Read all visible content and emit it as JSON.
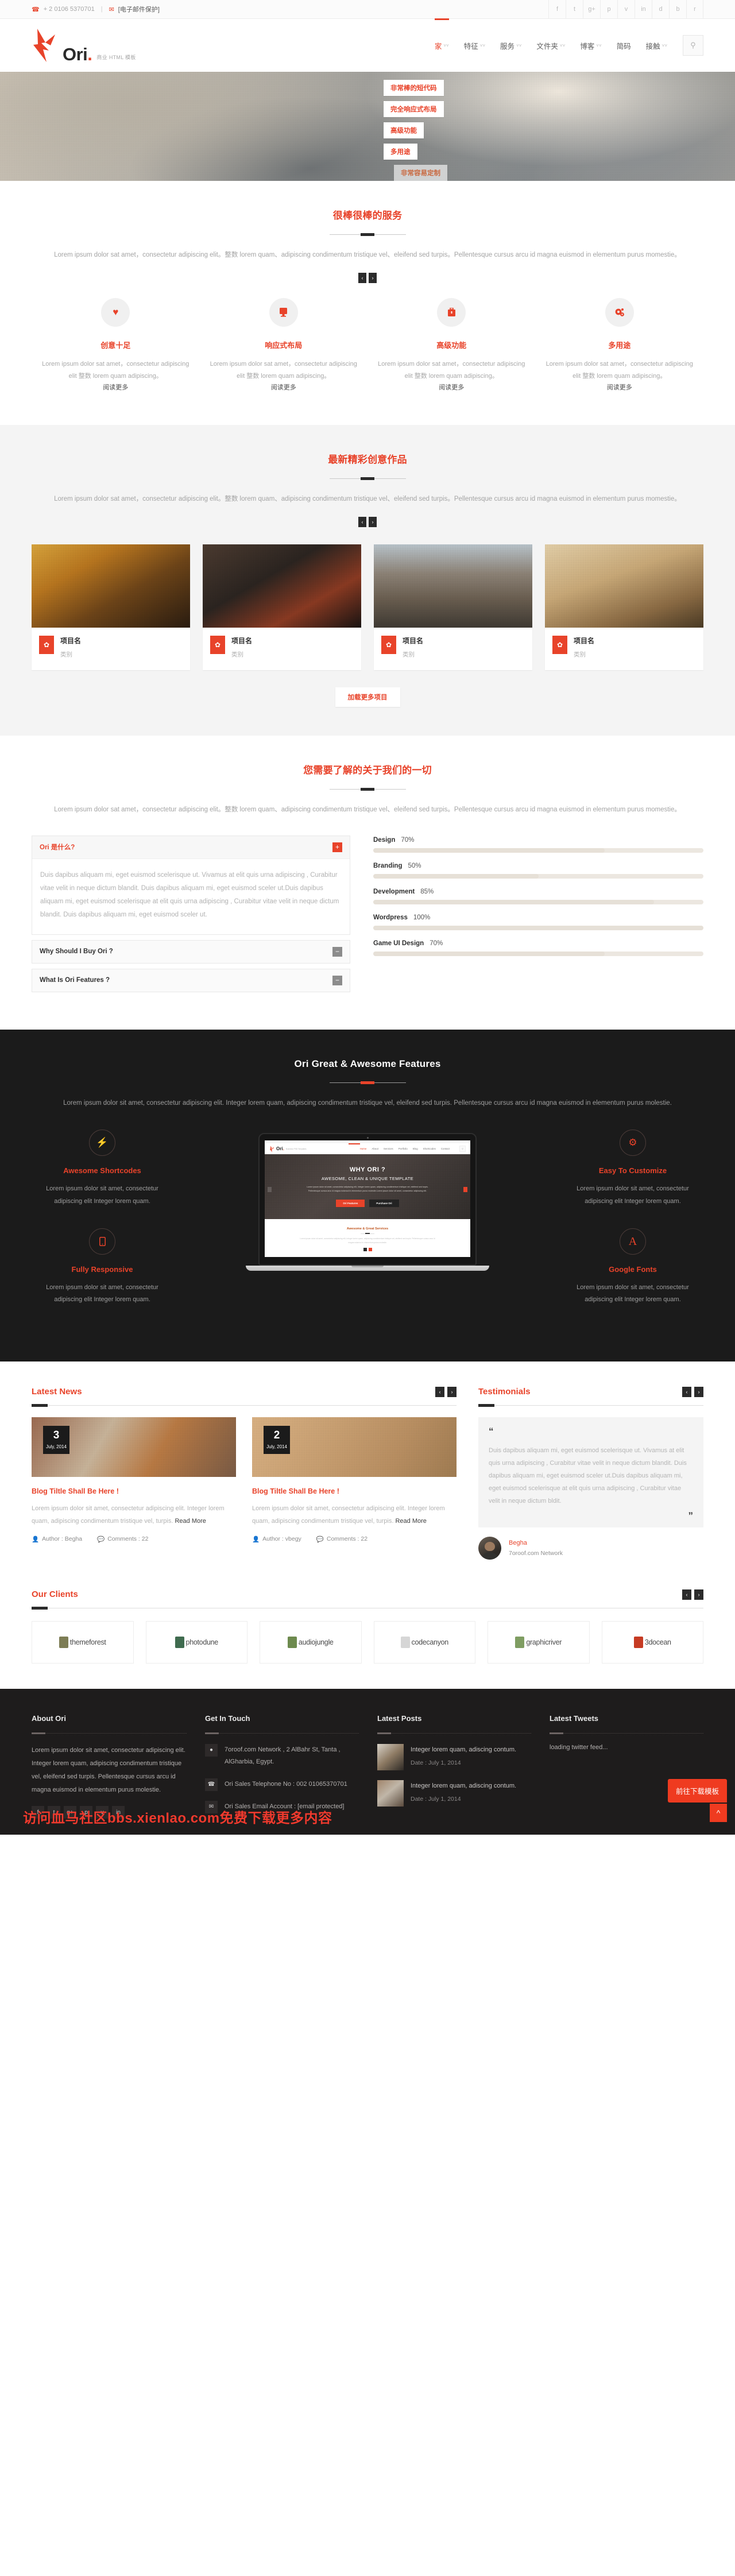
{
  "topbar": {
    "phone": "+ 2 0106 5370701",
    "separator": "|",
    "email": "[电子邮件保护]",
    "phone_icon": "phone-icon",
    "mail_icon": "mail-icon",
    "socials": [
      "f",
      "t",
      "g+",
      "p",
      "v",
      "in",
      "d",
      "b",
      "r"
    ]
  },
  "brand": {
    "name": "Ori",
    "dot": ".",
    "tagline": "商业 HTML 模板"
  },
  "nav": {
    "items": [
      {
        "label": "家",
        "active": true,
        "caret": true
      },
      {
        "label": "特征",
        "active": false,
        "caret": true
      },
      {
        "label": "服务",
        "active": false,
        "caret": true
      },
      {
        "label": "文件夹",
        "active": false,
        "caret": true
      },
      {
        "label": "博客",
        "active": false,
        "caret": true
      },
      {
        "label": "简码",
        "active": false,
        "caret": false
      },
      {
        "label": "接触",
        "active": false,
        "caret": true
      }
    ],
    "search_icon": "search-icon"
  },
  "hero": {
    "buttons": [
      "非常棒的短代码",
      "完全响应式布局",
      "高级功能",
      "多用途"
    ],
    "faded_button": "非常容易定制"
  },
  "services_section": {
    "title": "很棒很棒的服务",
    "description": "Lorem ipsum dolor sat amet，consectetur adipiscing elit。整数 lorem quam、adipiscing condimentum tristique vel、eleifend sed turpis。Pellentesque cursus arcu id magna euismod in elementum purus momestie。",
    "prev": "‹",
    "next": "›",
    "items": [
      {
        "icon": "heart-icon",
        "glyph": "♥",
        "title": "创意十足",
        "text": "Lorem ipsum dolor sat amet，consectetur adipiscing elit 整数 lorem quam adipiscing。",
        "more": "阅读更多"
      },
      {
        "icon": "monitor-icon",
        "glyph": "⎕",
        "title": "响应式布局",
        "text": "Lorem ipsum dolor sat amet，consectetur adipiscing elit 整数 lorem quam adipiscing。",
        "more": "阅读更多"
      },
      {
        "icon": "briefcase-icon",
        "glyph": "ὋC",
        "title": "高级功能",
        "text": "Lorem ipsum dolor sat amet，consectetur adipiscing elit 整数 lorem quam adipiscing。",
        "more": "阅读更多"
      },
      {
        "icon": "gears-icon",
        "glyph": "⚙",
        "title": "多用途",
        "text": "Lorem ipsum dolor sat amet，consectetur adipiscing elit 整数 lorem quam adipiscing。",
        "more": "阅读更多"
      }
    ]
  },
  "portfolio_section": {
    "title": "最新精彩创意作品",
    "description": "Lorem ipsum dolor sat amet，consectetur adipiscing elit。整数 lorem quam、adipiscing condimentum tristique vel、eleifend sed turpis。Pellentesque cursus arcu id magna euismod in elementum purus momestie。",
    "prev": "‹",
    "next": "›",
    "load_more": "加载更多项目",
    "items": [
      {
        "name": "项目名",
        "category": "类别",
        "icon": "leaf-icon"
      },
      {
        "name": "项目名",
        "category": "类别",
        "icon": "leaf-icon"
      },
      {
        "name": "项目名",
        "category": "类别",
        "icon": "leaf-icon"
      },
      {
        "name": "项目名",
        "category": "类别",
        "icon": "leaf-icon"
      }
    ]
  },
  "about_section": {
    "title": "您需要了解的关于我们的一切",
    "description": "Lorem ipsum dolor sat amet，consectetur adipiscing elit。整数 lorem quam、adipiscing condimentum tristique vel、eleifend sed turpis。Pellentesque cursus arcu id magna euismod in elementum purus momestie。",
    "accordion": [
      {
        "question": "Ori 是什么?",
        "open": true,
        "sign": "+",
        "answer": "Duis dapibus aliquam mi, eget euismod scelerisque ut. Vivamus at elit quis urna adipiscing , Curabitur vitae velit in neque dictum blandit. Duis dapibus aliquam mi, eget euismod sceler ut.Duis dapibus aliquam mi, eget euismod scelerisque at elit quis urna adipiscing , Curabitur vitae velit in neque dictum blandit. Duis dapibus aliquam mi, eget euismod sceler ut."
      },
      {
        "question": "Why Should I Buy Ori ?",
        "open": false,
        "sign": "−",
        "answer": ""
      },
      {
        "question": "What Is Ori Features ?",
        "open": false,
        "sign": "−",
        "answer": ""
      }
    ],
    "skills": [
      {
        "label": "Design",
        "percent": "70%",
        "value": 70
      },
      {
        "label": "Branding",
        "percent": "50%",
        "value": 50
      },
      {
        "label": "Development",
        "percent": "85%",
        "value": 85
      },
      {
        "label": "Wordpress",
        "percent": "100%",
        "value": 100
      },
      {
        "label": "Game UI Design",
        "percent": "70%",
        "value": 70
      }
    ]
  },
  "features_section": {
    "title": "Ori Great & Awesome Features",
    "description": "Lorem ipsum dolor sit amet, consectetur adipiscing elit. Integer lorem quam, adipiscing condimentum tristique vel, eleifend sed turpis. Pellentesque cursus arcu id magna euismod in elementum purus molestie.",
    "left": [
      {
        "icon": "bolt-icon",
        "glyph": "⚡",
        "title": "Awesome Shortcodes",
        "text": "Lorem ipsum dolor sit amet, consectetur adipiscing elit Integer lorem quam."
      },
      {
        "icon": "mobile-icon",
        "glyph": "☐",
        "title": "Fully Responsive",
        "text": "Lorem ipsum dolor sit amet, consectetur adipiscing elit Integer lorem quam."
      }
    ],
    "right": [
      {
        "icon": "gear-icon",
        "glyph": "⚙",
        "title": "Easy To Customize",
        "text": "Lorem ipsum dolor sit amet, consectetur adipiscing elit Integer lorem quam."
      },
      {
        "icon": "font-icon",
        "glyph": "A",
        "title": "Google Fonts",
        "text": "Lorem ipsum dolor sit amet, consectetur adipiscing elit Integer lorem quam."
      }
    ],
    "laptop_preview": {
      "topbar_phone": "+ 2 0106 5370701",
      "topbar_email": "Sales@7oroof.com",
      "logo": "Ori",
      "logo_dot": ".",
      "logo_sub": "Business PSD Templates",
      "menu": [
        "Home",
        "About",
        "Services",
        "Portfolio",
        "Blog",
        "Shortcodes",
        "Contact"
      ],
      "hero_title": "WHY ORI ?",
      "hero_subtitle": "AWESOME, CLEAN & UNIQUE TEMPLATE",
      "hero_text": "Lorem ipsum dolor sit amet, consectetur adipiscing elit, Integer lorem quam, adipiscing condimentum tristique vel, eleifend sed turpis. Pellentesque cursus arcu id magna euismod in elementum purus molestie.Lorem ipsum dolor sit amet, consectetur adipiscing elit.",
      "btn_primary": "Ori Features",
      "btn_secondary": "Purchase Ori",
      "section_title": "Awesome & Great Services",
      "section_text": "Lorem ipsum dolor sit amet, consectetur adipiscing elit, Integer lorem quam, adipiscing condimentum tristique vel, eleifend sed turpis. Pellentesque cursus arcu id magna euismod in elementum purus molestie."
    }
  },
  "news_section": {
    "title": "Latest News",
    "prev": "‹",
    "next": "›",
    "posts": [
      {
        "day": "3",
        "month": "July, 2014",
        "title": "Blog Tiltle Shall Be Here !",
        "excerpt": "Lorem ipsum dolor sit amet, consectetur adipiscing elit. Integer lorem quam, adipiscing condimentum tristique vel, turpis.",
        "read_more": "Read More",
        "author": "Author : Begha",
        "comments": "Comments : 22"
      },
      {
        "day": "2",
        "month": "July, 2014",
        "title": "Blog Tiltle Shall Be Here !",
        "excerpt": "Lorem ipsum dolor sit amet, consectetur adipiscing elit. Integer lorem quam, adipiscing condimentum tristique vel, turpis.",
        "read_more": "Read More",
        "author": "Author : vbegy",
        "comments": "Comments : 22"
      }
    ]
  },
  "testimonials_section": {
    "title": "Testimonials",
    "prev": "‹",
    "next": "›",
    "quote_open": "“",
    "quote_close": "”",
    "quote": "Duis dapibus aliquam mi, eget euismod scelerisque ut. Vivamus at elit quis urna adipiscing , Curabitur vitae velit in neque dictum blandit. Duis dapibus aliquam mi, eget euismod sceler ut.Duis dapibus aliquam mi, eget euismod scelerisque at elit quis urna adipiscing , Curabitur vitae velit in neque dictum bldit.",
    "author": "Begha",
    "company": "7oroof.com Network"
  },
  "clients_section": {
    "title": "Our Clients",
    "prev": "‹",
    "next": "›",
    "items": [
      {
        "name": "themeforest",
        "color": "#8a8a5e"
      },
      {
        "name": "photodune",
        "color": "#4c7f5d"
      },
      {
        "name": "audiojungle",
        "color": "#6f8a55"
      },
      {
        "name": "codecanyon",
        "color": "#dedede"
      },
      {
        "name": "graphicriver",
        "color": "#7d9b63"
      },
      {
        "name": "3docean",
        "color": "#c63b23"
      }
    ]
  },
  "footer": {
    "about": {
      "title": "About Ori",
      "text": "Lorem ipsum dolor sit amet, consectetur adipiscing elit. Integer lorem quam, adipiscing condimentum tristique vel, eleifend sed turpis. Pellentesque cursus arcu id magna euismod in elementum purus molestie.",
      "socials": [
        "f",
        "t",
        "g+",
        "p",
        "v",
        "in"
      ]
    },
    "contact": {
      "title": "Get In Touch",
      "items": [
        {
          "icon": "location-icon",
          "glyph": "⚑",
          "text": "7oroof.com Network , 2 AlBahr St, Tanta , AlGharbia, Egypt."
        },
        {
          "icon": "phone-icon",
          "glyph": "✆",
          "text": "Ori Sales Telephone No : 002 01065370701"
        },
        {
          "icon": "mail-icon",
          "glyph": "✉",
          "text": "Ori Sales Email Account : [email protected]"
        }
      ]
    },
    "latest_posts": {
      "title": "Latest Posts",
      "items": [
        {
          "title": "Integer lorem quam, adiscing contum.",
          "date": "Date : July 1, 2014"
        },
        {
          "title": "Integer lorem quam, adiscing contum.",
          "date": "Date : July 1, 2014"
        }
      ]
    },
    "latest_tweets": {
      "title": "Latest Tweets",
      "text": "loading twitter feed..."
    },
    "watermark": "访问血马社区bbs.xienlao.com免费下载更多内容",
    "download_badge": "前往下载模板",
    "to_top_icon": "chevron-up-icon"
  },
  "colors": {
    "accent": "#e8432a",
    "dark": "#1b1b1b",
    "footer": "#1e1c1c",
    "muted": "#a9a9a9"
  }
}
